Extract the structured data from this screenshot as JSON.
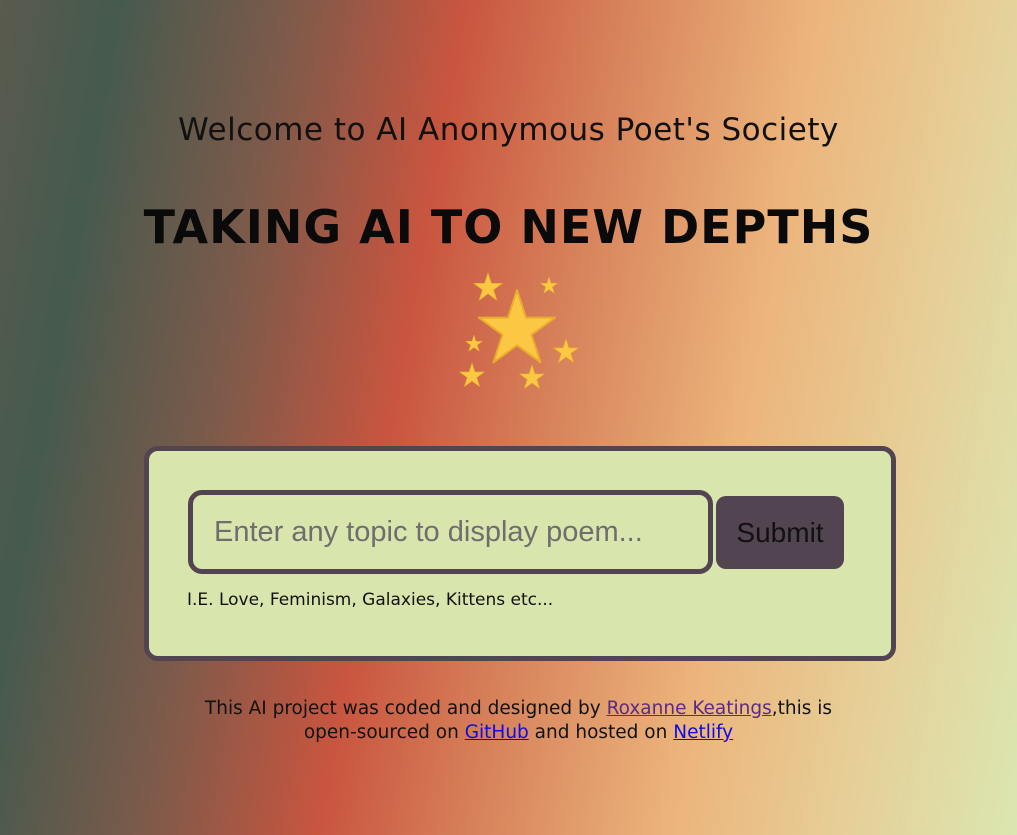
{
  "header": {
    "welcome": "Welcome to AI Anonymous Poet's Society",
    "tagline": "TAKING AI TO NEW DEPTHS",
    "emoji_name": "sparkling-stars-icon"
  },
  "form": {
    "placeholder": "Enter any topic to display poem...",
    "value": "",
    "submit_label": "Submit",
    "hint": "I.E. Love, Feminism, Galaxies, Kittens etc..."
  },
  "footer": {
    "text_before_author": "This AI project was coded and designed by ",
    "author_link": "Roxanne Keatings",
    "text_after_author": ",this is",
    "text_open_sourced": "open-sourced on ",
    "github_link": "GitHub",
    "text_hosted": " and hosted on ",
    "netlify_link": "Netlify"
  },
  "colors": {
    "card_bg": "#d8e5ad",
    "border": "#524451",
    "button_bg": "#524451",
    "link": "#0c0ce8",
    "visited_link": "#5b2a86",
    "star": "#fcc843"
  }
}
